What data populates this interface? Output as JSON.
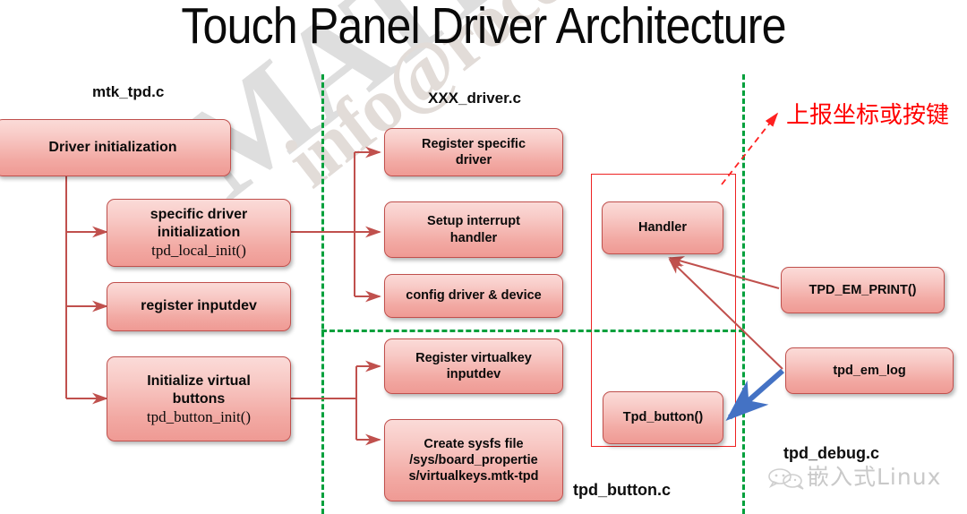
{
  "title": "Touch Panel Driver Architecture",
  "watermarks": {
    "line1": "MATERIAL CONFIDENTIAL",
    "line2": "info@rocomin.com USE"
  },
  "colors": {
    "box_border": "#c0504d",
    "box_fill_top": "#fbdbd8",
    "box_fill_bottom": "#ef9a94",
    "separator_green": "#00a03c",
    "group_red": "#ee2222",
    "arrow_red": "#c0504d",
    "arrow_blue": "#4472c4",
    "annotation_red": "#ff0000"
  },
  "sections": {
    "left_label": "mtk_tpd.c",
    "middle_label": "XXX_driver.c",
    "bottom_middle_label": "tpd_button.c",
    "right_label": "tpd_debug.c",
    "annotation_cn": "上报坐标或按键"
  },
  "boxes": {
    "driver_init": {
      "title": "Driver initialization"
    },
    "specific_driver_init": {
      "title": "specific driver\ninitialization",
      "fn": "tpd_local_init()"
    },
    "register_inputdev": {
      "title": "register inputdev"
    },
    "init_virtual_buttons": {
      "title": "Initialize virtual\nbuttons",
      "fn": "tpd_button_init()"
    },
    "register_specific_driver": {
      "title": "Register specific\ndriver"
    },
    "setup_interrupt_handler": {
      "title": "Setup interrupt\nhandler"
    },
    "config_driver_device": {
      "title": "config driver & device"
    },
    "register_virtualkey_inputdev": {
      "title": "Register virtualkey\ninputdev"
    },
    "create_sysfs_file": {
      "title": "Create sysfs file\n/sys/board_propertie\ns/virtualkeys.mtk-tpd"
    },
    "handler": {
      "title": "Handler"
    },
    "tpd_button": {
      "title": "Tpd_button()"
    },
    "tpd_em_print": {
      "title": "TPD_EM_PRINT()"
    },
    "tpd_em_log": {
      "title": "tpd_em_log"
    }
  },
  "wechat_badge": {
    "text": "嵌入式Linux"
  }
}
